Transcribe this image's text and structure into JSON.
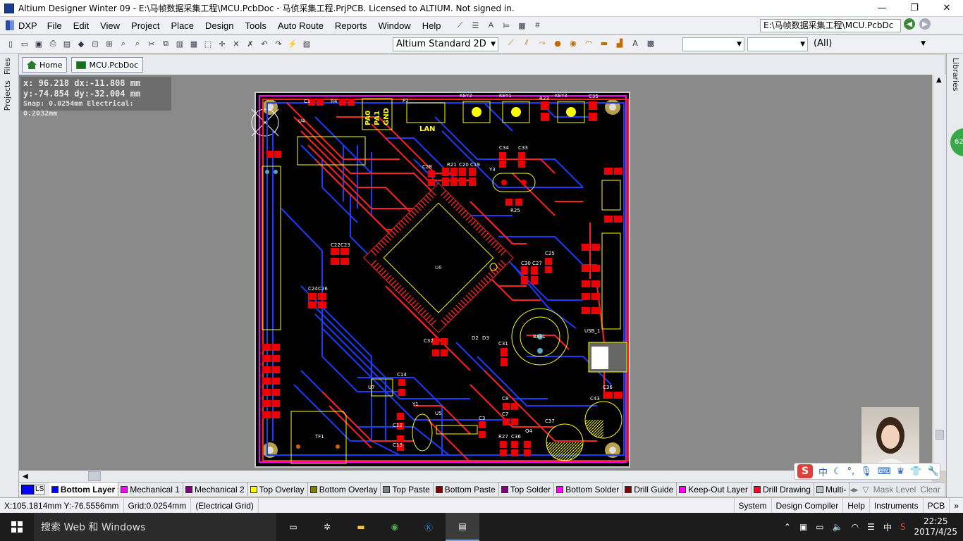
{
  "window": {
    "title": "Altium Designer Winter 09 - E:\\马帧数据采集工程\\MCU.PcbDoc - 马侦采集工程.PrjPCB. Licensed to ALTIUM. Not signed in.",
    "minimize": "—",
    "maximize": "❐",
    "close": "✕"
  },
  "menu": {
    "items": [
      "DXP",
      "File",
      "Edit",
      "View",
      "Project",
      "Place",
      "Design",
      "Tools",
      "Auto Route",
      "Reports",
      "Window",
      "Help"
    ],
    "path": "E:\\马帧数据采集工程\\MCU.PcbDc"
  },
  "toolbar": {
    "view_mode": "Altium Standard 2D",
    "filter_all": "(All)"
  },
  "sidepanels": {
    "left": [
      "Files",
      "Projects"
    ],
    "right": [
      "Libraries"
    ]
  },
  "tabs": {
    "home": "Home",
    "doc": "MCU.PcbDoc"
  },
  "hud": {
    "line1": "x: 96.218   dx:-11.808 mm",
    "line2": "y:-74.854   dy:-32.004  mm",
    "line3": "Snap: 0.0254mm Electrical: 0.2032mm"
  },
  "pcb": {
    "refs": {
      "key2": "KEY2",
      "key1": "KEY1",
      "key3": "KEY3",
      "r23": "R23",
      "c35": "C35",
      "p2": "P2",
      "lan": "LAN",
      "pa0": "PA0",
      "pa1": "PA1",
      "gnd": "GND",
      "c1": "C1",
      "r4": "R4",
      "u4": "U4",
      "c34": "C34",
      "c33": "C33",
      "r21": "R21",
      "c20": "C20",
      "c19": "C19",
      "c28": "C28",
      "y3": "Y3",
      "r25": "R25",
      "c22": "C22",
      "c23": "C23",
      "c24": "C24",
      "c26": "C26",
      "u6": "U6",
      "c30": "C30",
      "c27": "C27",
      "c25": "C25",
      "bat1": "BAT1",
      "d2": "D2",
      "d3": "D3",
      "c31": "C31",
      "c32": "C32",
      "usb1": "USB_1",
      "c14": "C14",
      "u7": "U7",
      "y1": "Y1",
      "u5": "U5",
      "c12": "C12",
      "c13": "C13",
      "c3": "C3",
      "c8": "C8",
      "c7": "C7",
      "r27": "R27",
      "c36": "C36",
      "q4": "Q4",
      "c37": "C37",
      "c43": "C43",
      "c36b": "C36",
      "tf1": "TF1"
    }
  },
  "layers": {
    "ls": "LS",
    "items": [
      {
        "label": "Bottom Layer",
        "color": "#0000ff",
        "active": true
      },
      {
        "label": "Mechanical 1",
        "color": "#ff00ff"
      },
      {
        "label": "Mechanical 2",
        "color": "#800080"
      },
      {
        "label": "Top Overlay",
        "color": "#ffff00"
      },
      {
        "label": "Bottom Overlay",
        "color": "#808000"
      },
      {
        "label": "Top Paste",
        "color": "#808080"
      },
      {
        "label": "Bottom Paste",
        "color": "#800000"
      },
      {
        "label": "Top Solder",
        "color": "#800080"
      },
      {
        "label": "Bottom Solder",
        "color": "#ff00ff"
      },
      {
        "label": "Drill Guide",
        "color": "#800000"
      },
      {
        "label": "Keep-Out Layer",
        "color": "#ff00ff"
      },
      {
        "label": "Drill Drawing",
        "color": "#ff002a"
      },
      {
        "label": "Multi-",
        "color": "#c0c0c0"
      }
    ],
    "mask_level": "Mask Level",
    "clear": "Clear"
  },
  "status": {
    "coords": "X:105.1814mm Y:-76.5556mm",
    "grid": "Grid:0.0254mm",
    "grid_type": "(Electrical Grid)",
    "right": [
      "System",
      "Design Compiler",
      "Help",
      "Instruments",
      "PCB"
    ]
  },
  "taskbar": {
    "search": "搜索 Web 和 Windows",
    "time": "22:25",
    "date": "2017/4/25",
    "ime": "中"
  },
  "badge": "62"
}
